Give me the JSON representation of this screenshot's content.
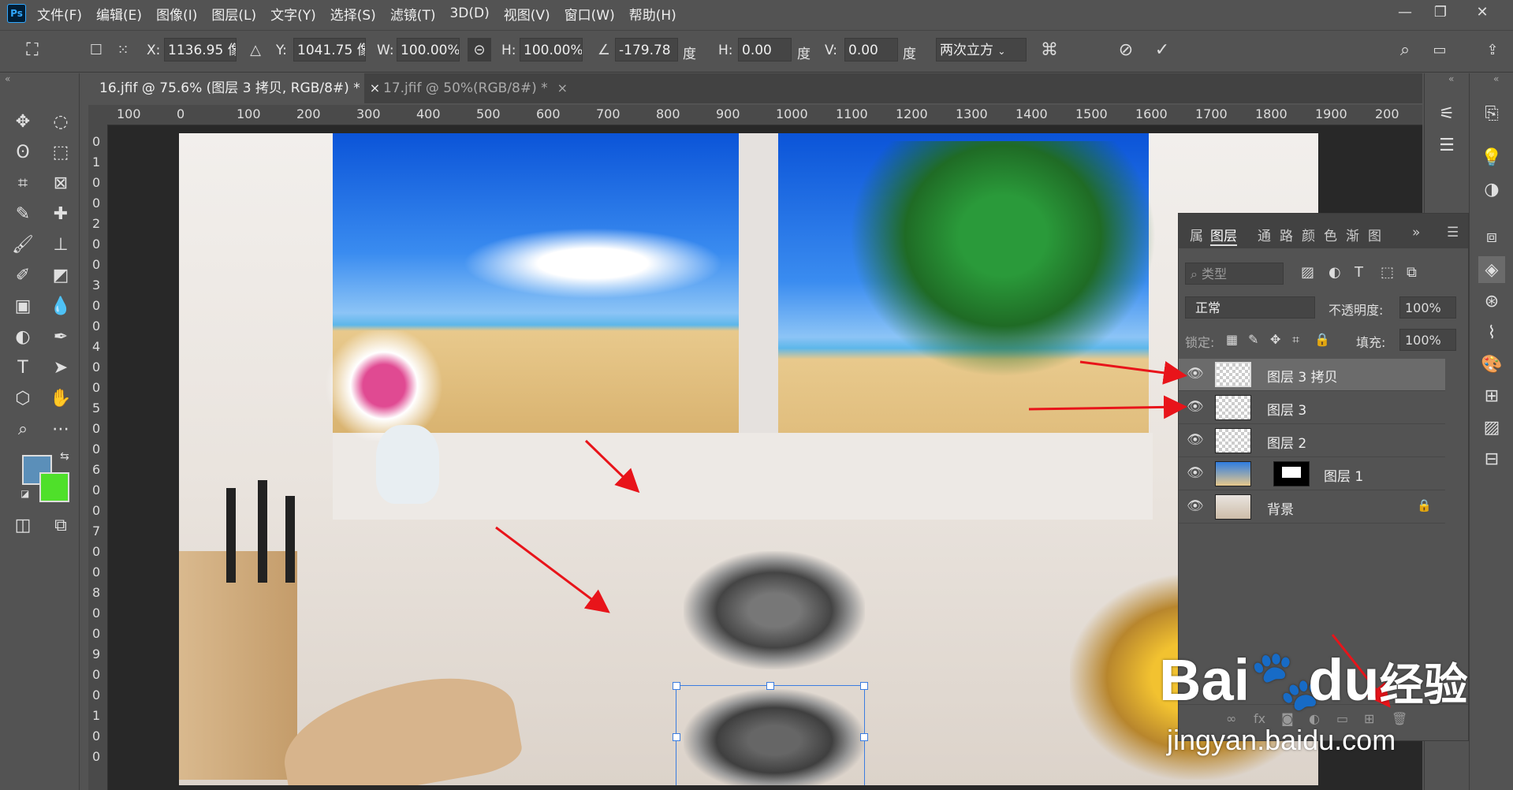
{
  "app": {
    "logo": "Ps"
  },
  "menu": [
    "文件(F)",
    "编辑(E)",
    "图像(I)",
    "图层(L)",
    "文字(Y)",
    "选择(S)",
    "滤镜(T)",
    "3D(D)",
    "视图(V)",
    "窗口(W)",
    "帮助(H)"
  ],
  "window_controls": {
    "minimize": "—",
    "restore": "❐",
    "close": "✕"
  },
  "options": {
    "x_label": "X:",
    "x_value": "1136.95 像",
    "y_label": "Y:",
    "y_value": "1041.75 像",
    "w_label": "W:",
    "w_value": "100.00%",
    "h_label": "H:",
    "h_value": "100.00%",
    "angle_value": "-179.78",
    "angle_unit": "度",
    "skew_h_label": "H:",
    "skew_h_value": "0.00",
    "skew_h_unit": "度",
    "skew_v_label": "V:",
    "skew_v_value": "0.00",
    "skew_v_unit": "度",
    "interpolation": "两次立方"
  },
  "tabs": [
    {
      "label": "16.jfif @ 75.6% (图层 3 拷贝, RGB/8#) *",
      "close": "×"
    },
    {
      "label": "17.jfif @ 50%(RGB/8#) *",
      "close": "×"
    }
  ],
  "ruler_h": [
    "100",
    "0",
    "100",
    "200",
    "300",
    "400",
    "500",
    "600",
    "700",
    "800",
    "900",
    "1000",
    "1100",
    "1200",
    "1300",
    "1400",
    "1500",
    "1600",
    "1700",
    "1800",
    "1900",
    "200"
  ],
  "ruler_v": [
    "0",
    "1",
    "0",
    "0",
    "2",
    "0",
    "0",
    "3",
    "0",
    "0",
    "4",
    "0",
    "0",
    "5",
    "0",
    "0",
    "6",
    "0",
    "0",
    "7",
    "0",
    "0",
    "8",
    "0",
    "0",
    "9",
    "0",
    "0",
    "1",
    "0",
    "0"
  ],
  "layers_panel": {
    "tabs": [
      "属",
      "图层",
      "通",
      "路",
      "颜",
      "色",
      "渐",
      "图"
    ],
    "filter_placeholder": "类型",
    "blend_mode": "正常",
    "opacity_label": "不透明度:",
    "opacity_value": "100%",
    "lock_label": "锁定:",
    "fill_label": "填充:",
    "fill_value": "100%",
    "layers": [
      {
        "name": "图层 3 拷贝",
        "selected": true
      },
      {
        "name": "图层 3",
        "selected": false
      },
      {
        "name": "图层 2",
        "selected": false
      },
      {
        "name": "图层 1",
        "selected": false
      },
      {
        "name": "背景",
        "selected": false
      }
    ]
  },
  "colors": {
    "foreground": "#5b8fb9",
    "background": "#4fe02a",
    "arrow": "#e8141a"
  },
  "watermark": {
    "brand": "Bai",
    "brand2": "du",
    "cn": "经验",
    "url": "jingyan.baidu.com"
  }
}
